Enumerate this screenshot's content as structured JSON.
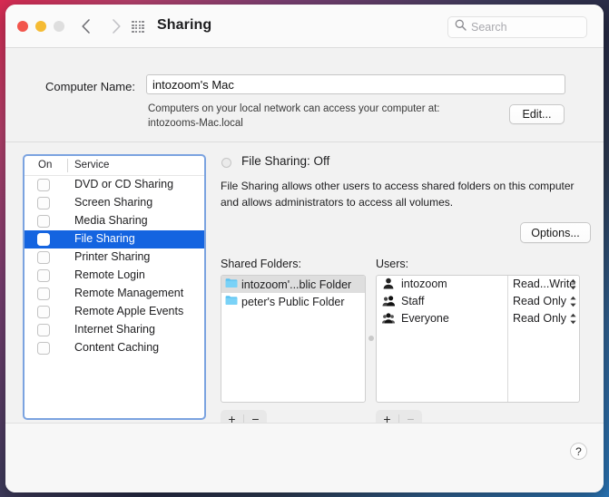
{
  "window": {
    "title": "Sharing",
    "traffic_lights": [
      "close",
      "minimize",
      "zoom"
    ],
    "nav": {
      "back": "back-chevron",
      "forward": "forward-chevron"
    },
    "grid_button": "show-all-icon"
  },
  "search": {
    "placeholder": "Search",
    "value": "",
    "icon": "search-icon"
  },
  "computer_name": {
    "label": "Computer Name:",
    "value": "intozoom's Mac",
    "help_line1": "Computers on your local network can access your computer at:",
    "help_line2": "intozooms-Mac.local",
    "edit_label": "Edit..."
  },
  "services": {
    "header_on": "On",
    "header_service": "Service",
    "items": [
      {
        "label": "DVD or CD Sharing",
        "checked": false,
        "selected": false
      },
      {
        "label": "Screen Sharing",
        "checked": false,
        "selected": false
      },
      {
        "label": "Media Sharing",
        "checked": false,
        "selected": false
      },
      {
        "label": "File Sharing",
        "checked": false,
        "selected": true
      },
      {
        "label": "Printer Sharing",
        "checked": false,
        "selected": false
      },
      {
        "label": "Remote Login",
        "checked": false,
        "selected": false
      },
      {
        "label": "Remote Management",
        "checked": false,
        "selected": false
      },
      {
        "label": "Remote Apple Events",
        "checked": false,
        "selected": false
      },
      {
        "label": "Internet Sharing",
        "checked": false,
        "selected": false
      },
      {
        "label": "Content Caching",
        "checked": false,
        "selected": false
      }
    ],
    "selection_color": "#1464e0"
  },
  "detail": {
    "status_title": "File Sharing: Off",
    "status_indicator": "off",
    "description": "File Sharing allows other users to access shared folders on this computer and allows administrators to access all volumes.",
    "options_label": "Options...",
    "shared_folders_label": "Shared Folders:",
    "users_label": "Users:",
    "shared_folders": [
      {
        "name": "intozoom'...blic Folder",
        "selected": true,
        "icon": "folder-icon"
      },
      {
        "name": "peter's Public Folder",
        "selected": false,
        "icon": "folder-icon"
      }
    ],
    "users": [
      {
        "name": "intozoom",
        "permission": "Read...Write",
        "icon": "single-user-icon"
      },
      {
        "name": "Staff",
        "permission": "Read Only",
        "icon": "group-two-users-icon"
      },
      {
        "name": "Everyone",
        "permission": "Read Only",
        "icon": "group-three-users-icon"
      }
    ],
    "folder_add": "+",
    "folder_remove": "−",
    "user_add": "+",
    "user_remove": "−"
  },
  "footer": {
    "help_label": "?"
  }
}
